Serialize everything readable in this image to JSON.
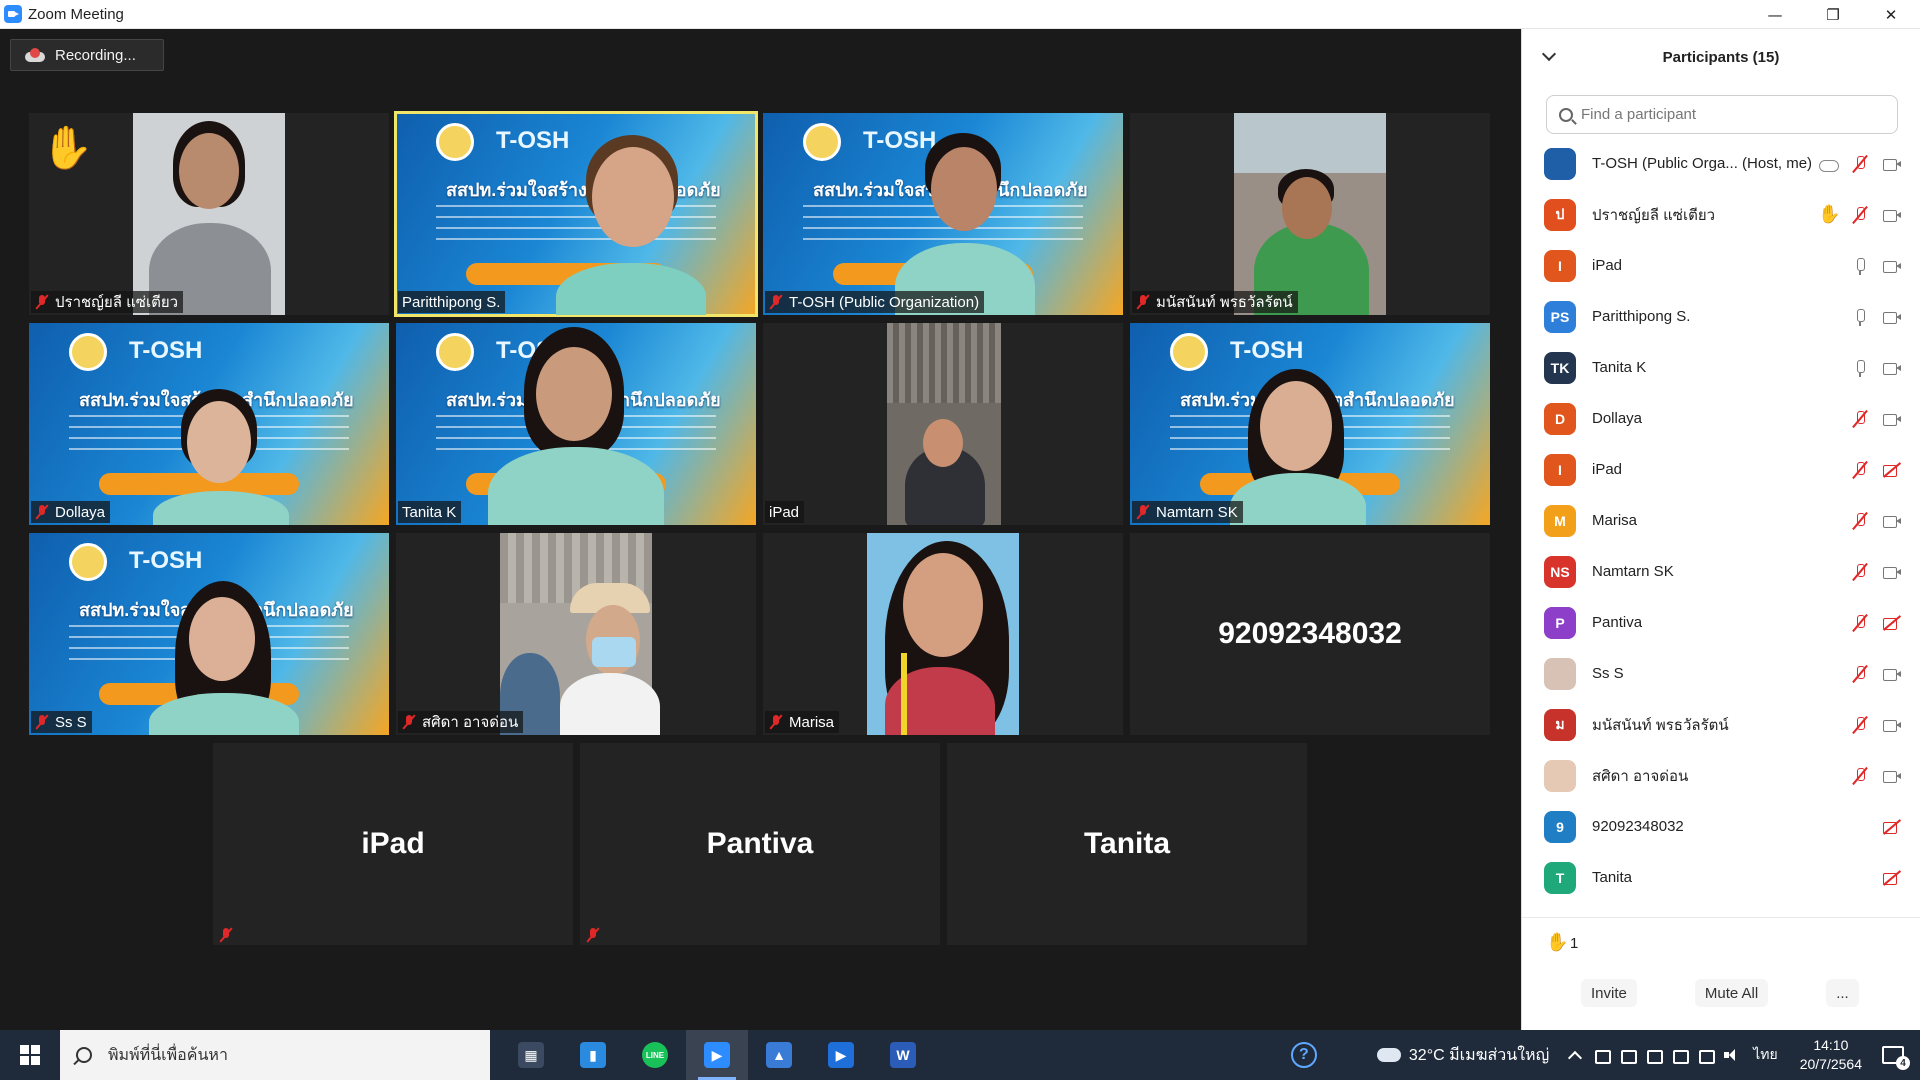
{
  "window": {
    "title": "Zoom Meeting",
    "controls": {
      "minimize": "—",
      "restore": "❐",
      "close": "✕"
    }
  },
  "recording": {
    "label": "Recording..."
  },
  "gallery": {
    "tiles": [
      {
        "name": "ปราชญ์ยลี แซ่เตียว",
        "muted": true,
        "raised_hand": true
      },
      {
        "name": "Paritthipong S.",
        "muted": false,
        "speaking": true
      },
      {
        "name": "T-OSH (Public Organization)",
        "muted": true
      },
      {
        "name": "มนัสนันท์ พรธวัลรัตน์",
        "muted": true
      },
      {
        "name": "Dollaya",
        "muted": true
      },
      {
        "name": "Tanita K",
        "muted": false
      },
      {
        "name": "iPad",
        "muted": false
      },
      {
        "name": "Namtarn SK",
        "muted": true
      },
      {
        "name": "Ss S",
        "muted": true
      },
      {
        "name": "สศิดา อาจด่อน",
        "muted": true
      },
      {
        "name": "Marisa",
        "muted": true
      },
      {
        "name": "92092348032",
        "video_off": true
      }
    ],
    "bottom_tiles": [
      {
        "name": "iPad",
        "muted": true
      },
      {
        "name": "Pantiva",
        "muted": true
      },
      {
        "name": "Tanita",
        "muted": false
      }
    ],
    "banner": {
      "logo": "T-OSH",
      "headline": "สสปท.ร่วมใจสร้างจิตสำนึกปลอดภัย"
    }
  },
  "participants": {
    "title": "Participants (15)",
    "search_placeholder": "Find a participant",
    "list": [
      {
        "initials": "",
        "avatar_color": "#1f5fa8",
        "name": "T-OSH (Public Orga... (Host, me)",
        "status": [
          "cloud",
          "mic-muted",
          "cam"
        ]
      },
      {
        "initials": "ป",
        "avatar_color": "#e04f1d",
        "name": "ปราชญ์ยลี แซ่เตียว",
        "status": [
          "hand",
          "mic-muted",
          "cam"
        ]
      },
      {
        "initials": "I",
        "avatar_color": "#e0561d",
        "name": "iPad",
        "status": [
          "mic",
          "cam"
        ]
      },
      {
        "initials": "PS",
        "avatar_color": "#2d7fd9",
        "name": "Paritthipong S.",
        "status": [
          "mic",
          "cam"
        ]
      },
      {
        "initials": "TK",
        "avatar_color": "#24364f",
        "name": "Tanita K",
        "status": [
          "mic",
          "cam"
        ]
      },
      {
        "initials": "D",
        "avatar_color": "#e0561d",
        "name": "Dollaya",
        "status": [
          "mic-muted",
          "cam"
        ]
      },
      {
        "initials": "I",
        "avatar_color": "#e0561d",
        "name": "iPad",
        "status": [
          "mic-muted",
          "cam-off"
        ]
      },
      {
        "initials": "M",
        "avatar_color": "#f2a01a",
        "name": "Marisa",
        "status": [
          "mic-muted",
          "cam"
        ]
      },
      {
        "initials": "NS",
        "avatar_color": "#d9342b",
        "name": "Namtarn SK",
        "status": [
          "mic-muted",
          "cam"
        ]
      },
      {
        "initials": "P",
        "avatar_color": "#8e3fc9",
        "name": "Pantiva",
        "status": [
          "mic-muted",
          "cam-off"
        ]
      },
      {
        "initials": "",
        "avatar_color": "#d8c2b6",
        "name": "Ss S",
        "status": [
          "mic-muted",
          "cam"
        ]
      },
      {
        "initials": "ม",
        "avatar_color": "#c7322b",
        "name": "มนัสนันท์ พรธวัลรัตน์",
        "status": [
          "mic-muted",
          "cam"
        ]
      },
      {
        "initials": "",
        "avatar_color": "#e6c9b4",
        "name": "สศิดา อาจด่อน",
        "status": [
          "mic-muted",
          "cam"
        ]
      },
      {
        "initials": "9",
        "avatar_color": "#1f7ec4",
        "name": "92092348032",
        "status": [
          "cam-off"
        ]
      },
      {
        "initials": "T",
        "avatar_color": "#1fa87a",
        "name": "Tanita",
        "status": [
          "cam-off"
        ]
      }
    ],
    "raised_hands": "1",
    "buttons": {
      "invite": "Invite",
      "mute_all": "Mute All",
      "more": "..."
    }
  },
  "taskbar": {
    "search_placeholder": "พิมพ์ที่นี่เพื่อค้นหา",
    "apps": [
      {
        "name": "task-view",
        "color": "#3b4a60",
        "glyph": "▦",
        "active": false
      },
      {
        "name": "file-manager",
        "color": "#2a8ae0",
        "glyph": "▮",
        "active": false
      },
      {
        "name": "line",
        "color": "#19c159",
        "glyph": "LINE",
        "active": false
      },
      {
        "name": "zoom",
        "color": "#2d8cff",
        "glyph": "▶",
        "active": true
      },
      {
        "name": "photos",
        "color": "#3a7bd5",
        "glyph": "▲",
        "active": false
      },
      {
        "name": "video-editor",
        "color": "#1e6fd9",
        "glyph": "▶",
        "active": false
      },
      {
        "name": "word",
        "color": "#2b5cb8",
        "glyph": "W",
        "active": false
      }
    ],
    "help": "?",
    "weather": "32°C  มีเมฆส่วนใหญ่",
    "language": "ไทย",
    "time": "14:10",
    "date": "20/7/2564",
    "notifications": "4"
  }
}
